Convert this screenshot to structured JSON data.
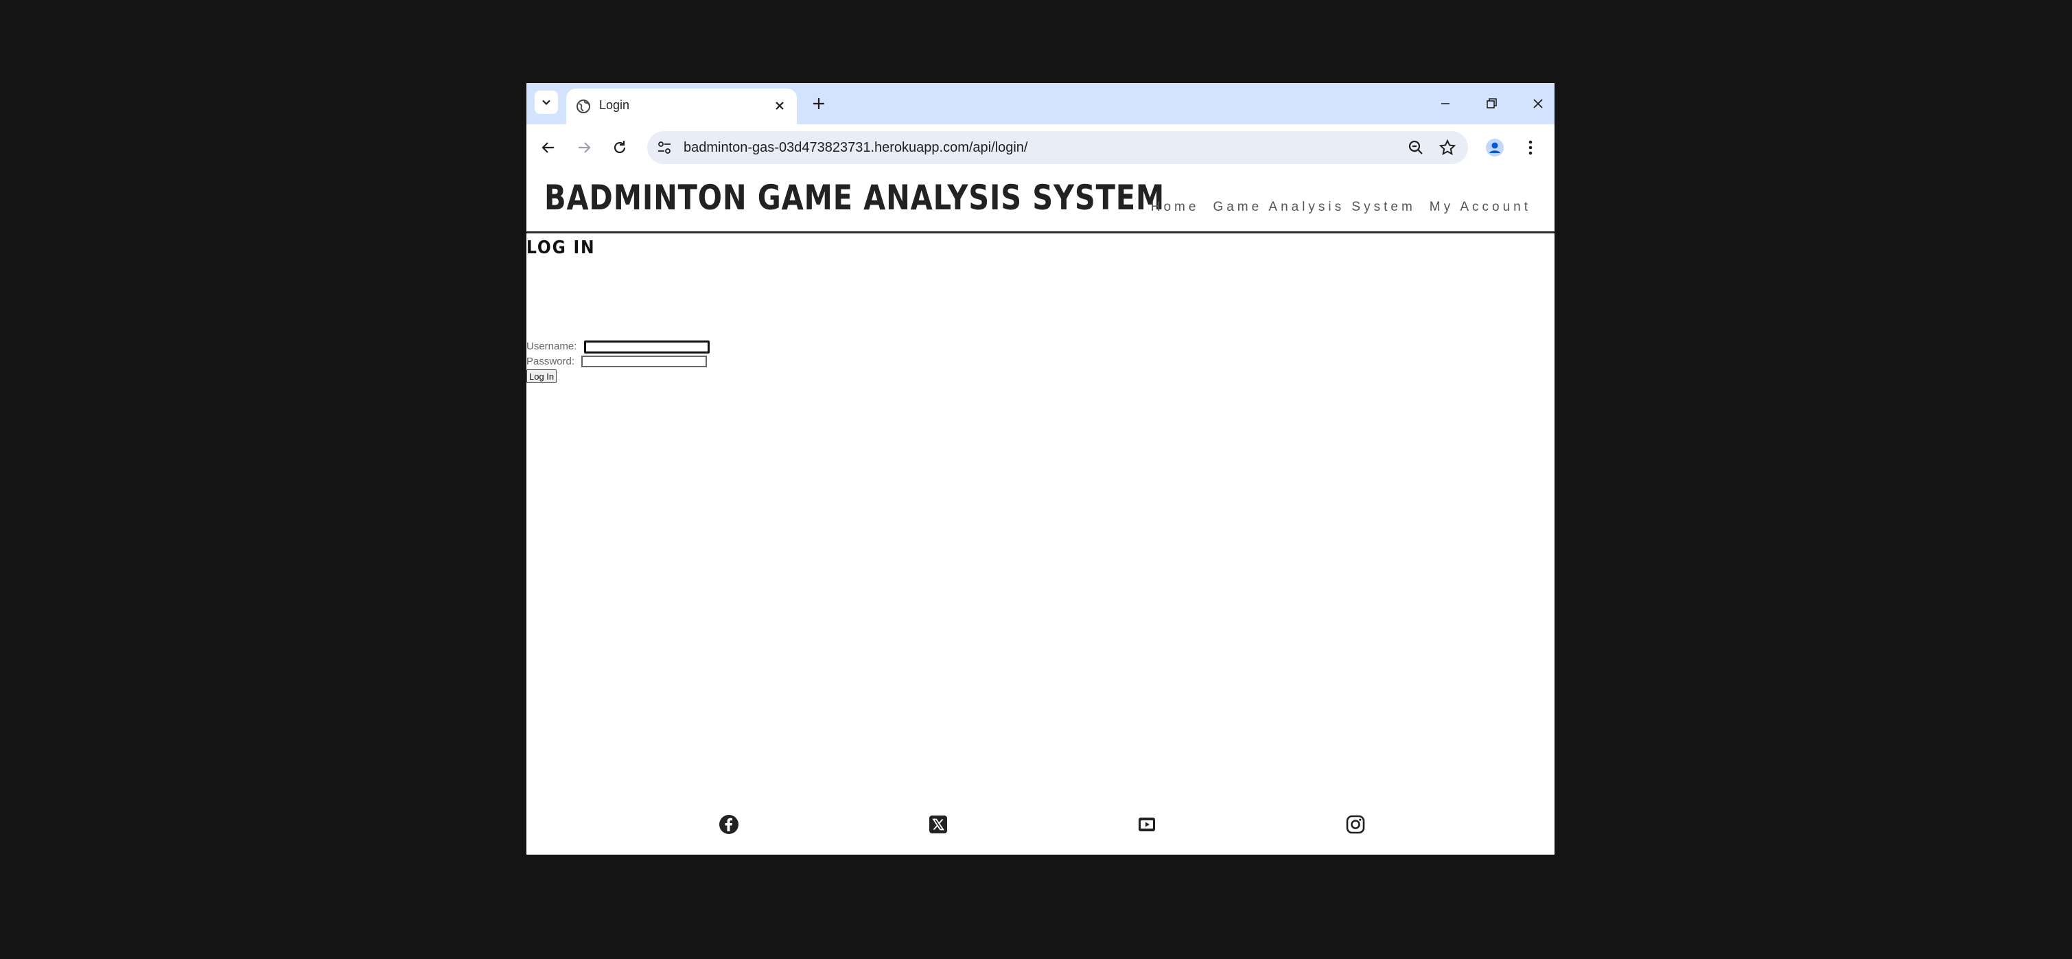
{
  "browser": {
    "tab_title": "Login",
    "url": "badminton-gas-03d473823731.herokuapp.com/api/login/"
  },
  "site": {
    "title": "BADMINTON GAME ANALYSIS SYSTEM",
    "nav": [
      "Home",
      "Game Analysis System",
      "My Account"
    ]
  },
  "login": {
    "heading": "LOG IN",
    "username_label": "Username:",
    "password_label": "Password:",
    "username_value": "",
    "password_value": "",
    "submit_label": "Log In"
  },
  "footer": {
    "social_icons": [
      "facebook-icon",
      "x-twitter-icon",
      "youtube-icon",
      "instagram-icon"
    ]
  },
  "colors": {
    "tabstrip": "#d3e3fd",
    "omnibox": "#e9eef6",
    "desktop": "#141414"
  }
}
